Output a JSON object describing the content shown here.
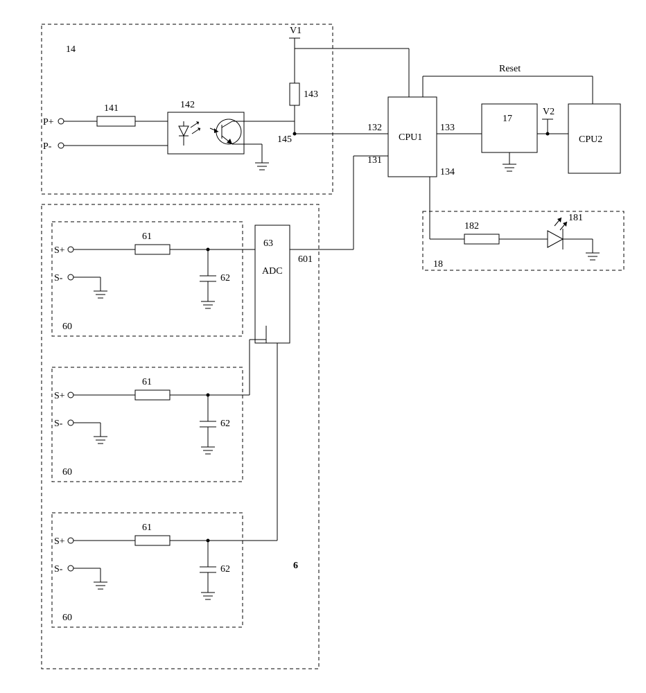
{
  "blocks": {
    "block14": {
      "label": "14"
    },
    "block6": {
      "label": "6"
    },
    "block60a": {
      "label": "60"
    },
    "block60b": {
      "label": "60"
    },
    "block60c": {
      "label": "60"
    },
    "block18": {
      "label": "18"
    },
    "cpu1": {
      "label": "CPU1"
    },
    "cpu2": {
      "label": "CPU2"
    },
    "adc": {
      "label": "ADC"
    },
    "v1": {
      "label": "V1"
    },
    "v2": {
      "label": "V2"
    },
    "reset": {
      "label": "Reset"
    }
  },
  "terminals": {
    "p_plus": "P+",
    "p_minus": "P-",
    "s_plus": "S+",
    "s_minus": "S-"
  },
  "components": {
    "r141": "141",
    "r142": "142",
    "r143": "143",
    "n145": "145",
    "r61": "61",
    "c62": "62",
    "n63": "63",
    "n131": "131",
    "n132": "132",
    "n133": "133",
    "n134": "134",
    "n601": "601",
    "led181": "181",
    "r182": "182",
    "n17": "17"
  },
  "chart_data": {
    "type": "diagram",
    "title": "Electronic block diagram with optocoupler, CPU1/CPU2, ADC channels, and LED indicator",
    "nodes": [
      {
        "id": "14",
        "role": "dashed block / optocoupler input stage"
      },
      {
        "id": "141",
        "role": "resistor in P+ line"
      },
      {
        "id": "142",
        "role": "optocoupler (LED + phototransistor)"
      },
      {
        "id": "143",
        "role": "pull-up resistor to V1"
      },
      {
        "id": "145",
        "role": "output node of optocoupler"
      },
      {
        "id": "V1",
        "role": "supply rail"
      },
      {
        "id": "CPU1",
        "role": "processor 1"
      },
      {
        "id": "131",
        "role": "CPU1 pin"
      },
      {
        "id": "132",
        "role": "CPU1 pin"
      },
      {
        "id": "133",
        "role": "CPU1 pin"
      },
      {
        "id": "134",
        "role": "CPU1 pin"
      },
      {
        "id": "17",
        "role": "block between CPU1 and CPU2"
      },
      {
        "id": "V2",
        "role": "supply rail into CPU2"
      },
      {
        "id": "CPU2",
        "role": "processor 2"
      },
      {
        "id": "Reset",
        "role": "Reset line CPU1↔CPU2"
      },
      {
        "id": "18",
        "role": "dashed block / LED output"
      },
      {
        "id": "182",
        "role": "resistor to LED 181"
      },
      {
        "id": "181",
        "role": "LED"
      },
      {
        "id": "6",
        "role": "dashed block / ADC group",
        "contains": [
          "60",
          "60",
          "60",
          "63"
        ]
      },
      {
        "id": "60",
        "role": "dashed sub-block (S+/S- input stage), repeated 3x"
      },
      {
        "id": "61",
        "role": "series resistor"
      },
      {
        "id": "62",
        "role": "capacitor to ground"
      },
      {
        "id": "63",
        "role": "ADC chip"
      },
      {
        "id": "601",
        "role": "ADC output line to CPU1"
      }
    ],
    "connections": [
      [
        "P+",
        "141"
      ],
      [
        "141",
        "142.LED_anode"
      ],
      [
        "P-",
        "142.LED_cathode"
      ],
      [
        "V1",
        "143"
      ],
      [
        "143",
        "145"
      ],
      [
        "142.transistor_collector",
        "145"
      ],
      [
        "142.transistor_emitter",
        "GND"
      ],
      [
        "V1",
        "CPU1.top"
      ],
      [
        "145",
        "CPU1.132"
      ],
      [
        "CPU1.133",
        "17"
      ],
      [
        "17",
        "CPU2"
      ],
      [
        "17",
        "GND"
      ],
      [
        "V2",
        "CPU2"
      ],
      [
        "CPU1.top",
        "Reset",
        "CPU2.top"
      ],
      [
        "CPU1.134",
        "182"
      ],
      [
        "182",
        "181"
      ],
      [
        "181",
        "GND"
      ],
      [
        "S+",
        "61"
      ],
      [
        "61",
        "62_top"
      ],
      [
        "62_top",
        "63"
      ],
      [
        "62_bottom",
        "GND"
      ],
      [
        "S-",
        "GND"
      ],
      [
        "63",
        "CPU1.131"
      ],
      [
        "63.out",
        "601"
      ]
    ],
    "counts": {
      "60_blocks": 3,
      "61_per_block": 1,
      "62_per_block": 1
    }
  }
}
